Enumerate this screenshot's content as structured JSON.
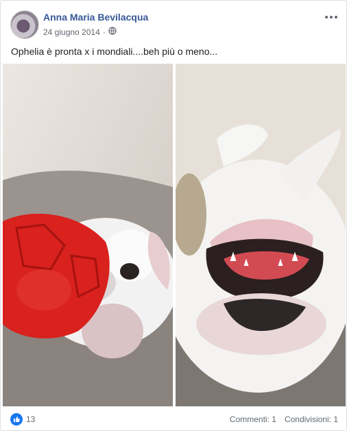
{
  "post": {
    "author": "Anna Maria Bevilacqua",
    "date": "24 giugno 2014",
    "separator": "·",
    "privacy_icon": "globe-icon",
    "more_icon": "more-options-icon",
    "text": "Ophelia è pronta x i mondiali....beh più o meno...",
    "photos": [
      {
        "subject": "bulldog-with-red-ball-photo"
      },
      {
        "subject": "bulldog-upside-down-photo"
      }
    ]
  },
  "footer": {
    "reaction_icon": "like-icon",
    "reaction_count": "13",
    "comments": "Commenti: 1",
    "shares": "Condivisioni: 1"
  },
  "colors": {
    "author": "#385898",
    "like_blue": "#1877f2",
    "meta": "#616770",
    "border": "#dddfe2"
  }
}
